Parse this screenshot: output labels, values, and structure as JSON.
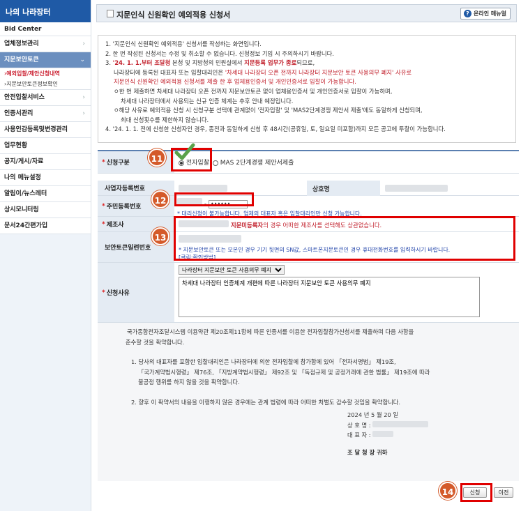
{
  "sidebar": {
    "title": "나의 나라장터",
    "bid_center": "Bid Center",
    "items": [
      {
        "label": "업체정보관리"
      },
      {
        "label": "지문보안토큰"
      },
      {
        "label": "안전입찰서비스"
      },
      {
        "label": "인증서관리"
      },
      {
        "label": "사용인감등록및변경관리"
      },
      {
        "label": "업무현황"
      },
      {
        "label": "공지/게시/자료"
      },
      {
        "label": "나의 메뉴설정"
      },
      {
        "label": "알림이/뉴스레터"
      },
      {
        "label": "상시모니터링"
      },
      {
        "label": "문서24간편가입"
      }
    ],
    "subitems": [
      {
        "label": "›예외입찰/제안신청내역"
      },
      {
        "label": "›지문보안토큰정보확인"
      }
    ]
  },
  "header": {
    "title": "지문인식 신원확인 예외적용 신청서",
    "manual_label": "온라인 매뉴얼"
  },
  "notice": {
    "l1": "1. '지문인식 신원확인 예외적용' 신청서를 작성하는 화면입니다.",
    "l2": "2. 한 번 작성된 신청서는 수정 및 취소할 수 없습니다. 신청정보 기입 시 주의하시기 바랍니다.",
    "l3a": "3. ",
    "l3b": "'24. 1. 1.부터 조달청",
    "l3c": " 본청 및 지방청의 민원실에서 ",
    "l3d": "지문등록 업무가 종료",
    "l3e": "되므로,",
    "l4a": "나라장터에 등록된 대표자 또는 입찰대리인은 ",
    "l4b": "'차세대 나라장터 오픈 전까지 나라장터 지문보안 토큰 사용의무 폐지' 사유로",
    "l5": "지문인식 신원확인 예외적용 신청서를 제출 한 후 업체용인증서 및 개인인증서로 입찰이 가능합니다.",
    "l6": "ㅇ한 번 제출하면 차세대 나라장터 오픈 전까지 지문보안토큰 없이 업체용인증서 및 개인인증서로 입찰이 가능하며,",
    "l7": "차세대 나라장터에서 사용되는 신규 인증 체계는 추후 안내 예정입니다.",
    "l8": "ㅇ해당 사유로 예외적용 신청 시 신청구분 선택에 관계없이 '전자입찰' 및 'MAS2단계경쟁 제안서 제출'에도 동일하게 신청되며,",
    "l9": "최대 신청횟수를 제한하지 않습니다.",
    "l10": "4. '24. 1. 1. 전에 신청한 신청자인 경우, 종전과 동일하게 신청 후 48시간(공휴일, 토, 일요일 미포함)까지 모든 공고에 투찰이 가능합니다."
  },
  "form": {
    "req_type_label": "신청구분",
    "opt1": "전자입찰",
    "opt2": "MAS 2단계경쟁 제안서제출",
    "bizno_label": "사업자등록번호",
    "company_label": "상호명",
    "rrn_label": "주민등록번호",
    "rrn_sep": "-",
    "rrn_back": "••••••",
    "rrn_note": "* 대리신청이 불가능합니다. 업체의 대표자 혹은 입찰대리인만 신청 가능합니다.",
    "maker_label": "제조사",
    "maker_note_bold": "지문미등록자",
    "maker_note": "의 경우 어떠한 제조사를 선택해도 상관없습니다.",
    "serial_label": "보안토큰일련번호",
    "serial_note": "* 지문보안토큰 또는 모본인 경우 기기 뒷면의 SN값, 스마트폰지문토큰인 경우 휴대전화번호를 입력하시기 바랍니다.",
    "serial_link": "[클릭:확인방법]",
    "reason_label": "신청사유",
    "reason_select": "나라장터 지문보안 토큰 사용의무 폐지",
    "reason_text": "차세대 나라장터 인증체계 개편에 따른 나라장터 지문보안 토큰 사용의무 폐지"
  },
  "pledge": {
    "p1": "국가종합전자조달시스템 이용약관 제20조제11항에 따른 인증서를 이용한 전자입찰참가신청서를 제출하며 다음 사항을",
    "p2": "준수할 것을 확약합니다.",
    "p3": "1. 당사의 대표자를 포함한 입찰대리인은 나라장터에 의한 전자입찰에 참가함에 있어 「전자서명법」 제19조,",
    "p4": "「국가계약법시행령」 제76조, 「지방계약법시행령」 제92조 및 「독점규제 및 공정거래에 관한 법률」 제19조에 따라",
    "p5": "불공정 행위를 하지 않을 것을 확약합니다.",
    "p6": "2. 향후 이 확약서의 내용을 이행하지 않은 경우에는 관계 법령에 따라 어떠한 처벌도 감수할 것임을 확약합니다.",
    "date": "2024 년 5 월 20 일",
    "company": "상 호 명 :",
    "ceo": "대 표 자 :",
    "addressee": "조 달 청 장  귀하"
  },
  "buttons": {
    "submit": "신청",
    "prev": "이전"
  },
  "badges": {
    "b11": "11",
    "b12": "12",
    "b13": "13",
    "b14": "14"
  }
}
